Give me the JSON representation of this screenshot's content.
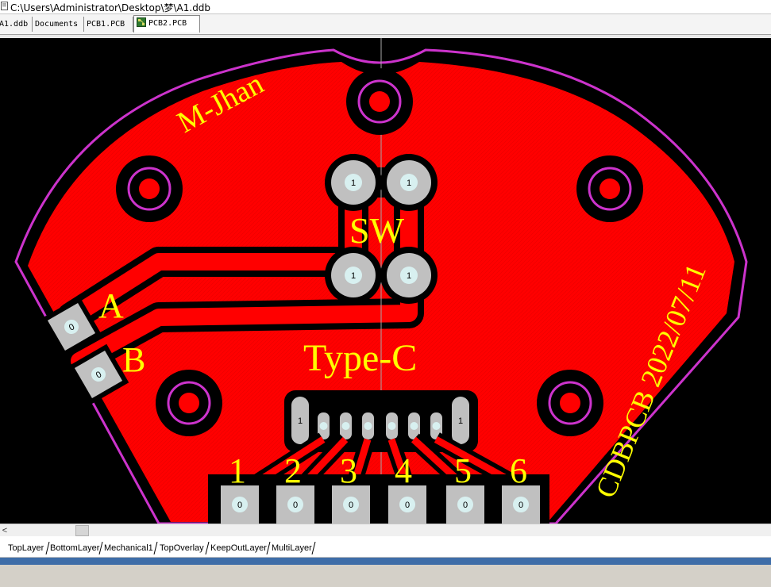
{
  "window": {
    "title": "C:\\Users\\Administrator\\Desktop\\梦\\A1.ddb"
  },
  "tabs": [
    {
      "label": "A1.ddb"
    },
    {
      "label": "Documents"
    },
    {
      "label": "PCB1.PCB"
    },
    {
      "label": "PCB2.PCB"
    }
  ],
  "board": {
    "labels": {
      "brand": "M-Jhan",
      "switch": "SW",
      "connector": "Type-C",
      "pad_a": "A",
      "pad_b": "B",
      "maker": "CDBPCB 2022/07/11"
    },
    "pin_numbers": [
      "1",
      "2",
      "3",
      "4",
      "5",
      "6"
    ],
    "pad_marks": {
      "switch_pad": "1",
      "edge_pad": "0",
      "usb_shell": "1"
    },
    "colors": {
      "background": "#000000",
      "copper": "#ff0000",
      "overlay_text": "#ffff00",
      "keepout": "#cc33cc",
      "pad": "#c0c0c0"
    }
  },
  "layers": [
    "TopLayer",
    "BottomLayer",
    "Mechanical1",
    "TopOverlay",
    "KeepOutLayer",
    "MultiLayer"
  ],
  "scrollbar": {
    "left_arrow": "<"
  }
}
